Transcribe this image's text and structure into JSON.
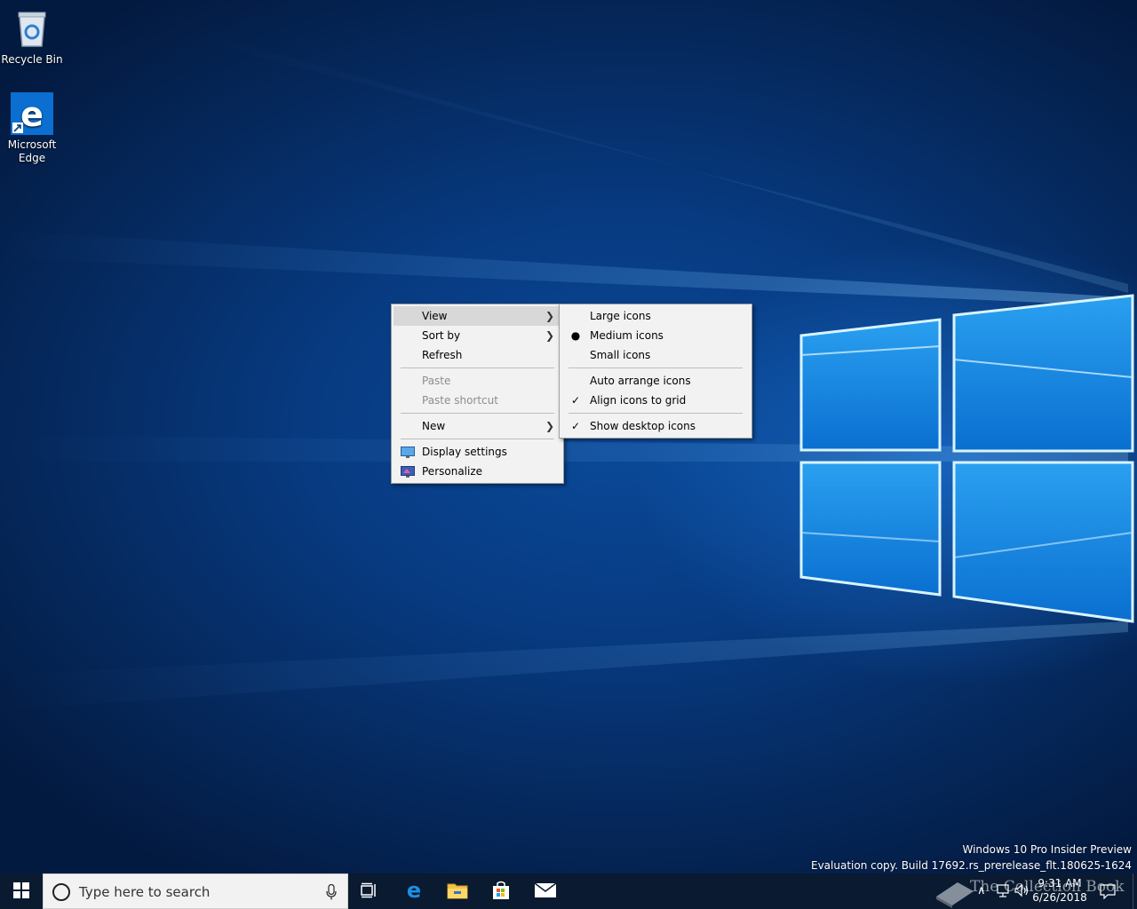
{
  "desktop": {
    "icons": [
      {
        "label": "Recycle Bin",
        "icon": "recycle-bin-icon"
      },
      {
        "label": "Microsoft\nEdge",
        "icon": "edge-icon"
      }
    ]
  },
  "context_menu": {
    "items": {
      "view": "View",
      "sort_by": "Sort by",
      "refresh": "Refresh",
      "paste": "Paste",
      "paste_shortcut": "Paste shortcut",
      "new": "New",
      "display_settings": "Display settings",
      "personalize": "Personalize"
    },
    "highlighted": "View"
  },
  "view_submenu": {
    "large_icons": "Large icons",
    "medium_icons": "Medium icons",
    "small_icons": "Small icons",
    "auto_arrange": "Auto arrange icons",
    "align_to_grid": "Align icons to grid",
    "show_desktop_icons": "Show desktop icons",
    "selected_size": "Medium icons",
    "checked": [
      "Align icons to grid",
      "Show desktop icons"
    ]
  },
  "watermark": {
    "line1": "Windows 10 Pro Insider Preview",
    "line2": "Evaluation copy. Build 17692.rs_prerelease_flt.180625-1624"
  },
  "taskbar": {
    "search_placeholder": "Type here to search",
    "pinned": [
      "start-icon",
      "task-view-icon",
      "edge-icon",
      "file-explorer-icon",
      "store-icon",
      "mail-icon"
    ],
    "clock_time": "9:31 AM",
    "clock_date": "6/26/2018",
    "brand_text": "The Collection Book"
  },
  "colors": {
    "menu_bg": "#f2f2f2",
    "menu_highlight": "#d8d8d8",
    "taskbar_bg": "#0a1a30",
    "accent": "#0078d7"
  }
}
